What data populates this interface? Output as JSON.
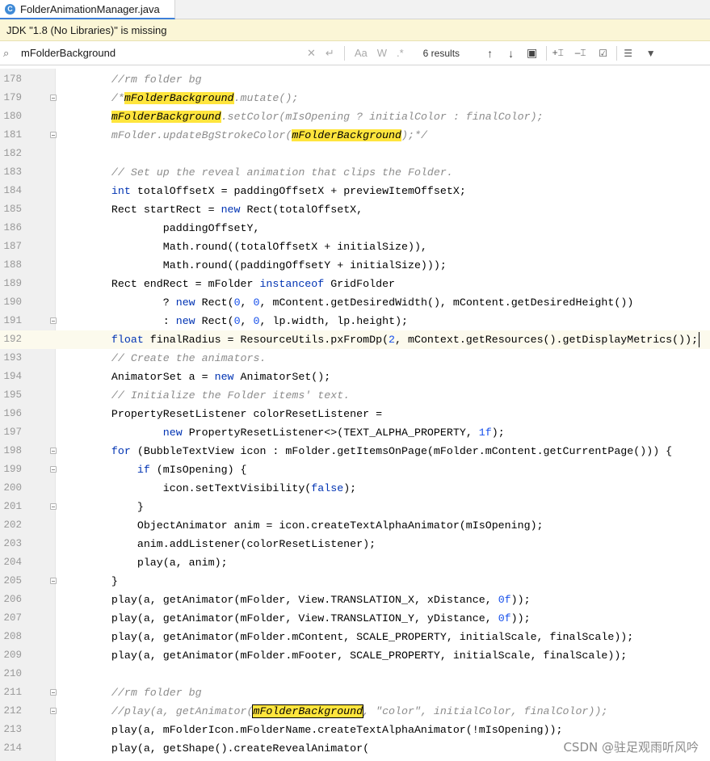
{
  "editor": {
    "tab": {
      "icon": "java-class-icon",
      "icon_glyph": "C",
      "title": "FolderAnimationManager.java"
    },
    "notice": "JDK \"1.8 (No Libraries)\" is missing",
    "find": {
      "query": "mFolderBackground",
      "results": "6 results",
      "icons": {
        "search": "search-icon",
        "clear": "clear-icon",
        "history": "replace-history-icon",
        "match_case": "match-case-icon",
        "words": "whole-words-icon",
        "regex": "regex-icon",
        "prev": "previous-occurrence-icon",
        "next": "next-occurrence-icon",
        "select_all": "select-all-occurrences-icon",
        "add": "add-selection-icon",
        "remove": "remove-selection-icon",
        "select_all2": "select-all-matches-icon",
        "filter_lines": "filter-lines-icon",
        "filter": "filter-icon"
      }
    },
    "watermark": "CSDN @驻足观雨听风吟",
    "current_line": 192,
    "lines": [
      {
        "n": "178",
        "fold": false,
        "tokens": [
          [
            "    //rm folder bg",
            "com"
          ]
        ]
      },
      {
        "n": "179",
        "fold": true,
        "tokens": [
          [
            "    /*",
            "com"
          ],
          [
            "mFolderBackground",
            "hl"
          ],
          [
            ".mutate();",
            "com"
          ]
        ]
      },
      {
        "n": "180",
        "fold": false,
        "tokens": [
          [
            "    ",
            ""
          ],
          [
            "mFolderBackground",
            "hl"
          ],
          [
            ".setColor(mIsOpening ? initialColor : finalColor);",
            "com"
          ]
        ]
      },
      {
        "n": "181",
        "fold": true,
        "tokens": [
          [
            "    mFolder.updateBgStrokeColor(",
            "com"
          ],
          [
            "mFolderBackground",
            "hl"
          ],
          [
            ");*/",
            "com"
          ]
        ]
      },
      {
        "n": "182",
        "fold": false,
        "tokens": []
      },
      {
        "n": "183",
        "fold": false,
        "tokens": [
          [
            "    // Set up the reveal animation that clips the Folder.",
            "com"
          ]
        ]
      },
      {
        "n": "184",
        "fold": false,
        "tokens": [
          [
            "    ",
            ""
          ],
          [
            "int",
            "kw"
          ],
          [
            " totalOffsetX = paddingOffsetX + previewItemOffsetX;",
            ""
          ]
        ]
      },
      {
        "n": "185",
        "fold": false,
        "tokens": [
          [
            "    Rect startRect = ",
            ""
          ],
          [
            "new",
            "kw"
          ],
          [
            " Rect(totalOffsetX,",
            ""
          ]
        ]
      },
      {
        "n": "186",
        "fold": false,
        "tokens": [
          [
            "            paddingOffsetY,",
            ""
          ]
        ]
      },
      {
        "n": "187",
        "fold": false,
        "tokens": [
          [
            "            Math.round((totalOffsetX + initialSize)),",
            ""
          ]
        ]
      },
      {
        "n": "188",
        "fold": false,
        "tokens": [
          [
            "            Math.round((paddingOffsetY + initialSize)));",
            ""
          ]
        ]
      },
      {
        "n": "189",
        "fold": false,
        "tokens": [
          [
            "    Rect endRect = mFolder ",
            ""
          ],
          [
            "instanceof",
            "kw"
          ],
          [
            " GridFolder",
            ""
          ]
        ]
      },
      {
        "n": "190",
        "fold": false,
        "tokens": [
          [
            "            ? ",
            ""
          ],
          [
            "new",
            "kw"
          ],
          [
            " Rect(",
            ""
          ],
          [
            "0",
            "num"
          ],
          [
            ", ",
            ""
          ],
          [
            "0",
            "num"
          ],
          [
            ", mContent.getDesiredWidth(), mContent.getDesiredHeight())",
            ""
          ]
        ]
      },
      {
        "n": "191",
        "fold": true,
        "tokens": [
          [
            "            : ",
            ""
          ],
          [
            "new",
            "kw"
          ],
          [
            " Rect(",
            ""
          ],
          [
            "0",
            "num"
          ],
          [
            ", ",
            ""
          ],
          [
            "0",
            "num"
          ],
          [
            ", lp.width, lp.height);",
            ""
          ]
        ]
      },
      {
        "n": "192",
        "fold": false,
        "tokens": [
          [
            "    ",
            ""
          ],
          [
            "float",
            "kw"
          ],
          [
            " finalRadius = ResourceUtils.pxFromDp(",
            ""
          ],
          [
            "2",
            "num"
          ],
          [
            ", mContext.getResources().getDisplayMetrics());",
            ""
          ]
        ]
      },
      {
        "n": "193",
        "fold": false,
        "tokens": [
          [
            "    // Create the animators.",
            "com"
          ]
        ]
      },
      {
        "n": "194",
        "fold": false,
        "tokens": [
          [
            "    AnimatorSet a = ",
            ""
          ],
          [
            "new",
            "kw"
          ],
          [
            " AnimatorSet();",
            ""
          ]
        ]
      },
      {
        "n": "195",
        "fold": false,
        "tokens": [
          [
            "    // Initialize the Folder items' text.",
            "com"
          ]
        ]
      },
      {
        "n": "196",
        "fold": false,
        "tokens": [
          [
            "    PropertyResetListener colorResetListener =",
            ""
          ]
        ]
      },
      {
        "n": "197",
        "fold": false,
        "tokens": [
          [
            "            ",
            ""
          ],
          [
            "new",
            "kw"
          ],
          [
            " PropertyResetListener<>(TEXT_ALPHA_PROPERTY, ",
            ""
          ],
          [
            "1f",
            "num"
          ],
          [
            ");",
            ""
          ]
        ]
      },
      {
        "n": "198",
        "fold": true,
        "tokens": [
          [
            "    ",
            ""
          ],
          [
            "for",
            "kw"
          ],
          [
            " (BubbleTextView icon : mFolder.getItemsOnPage(mFolder.mContent.getCurrentPage())) {",
            ""
          ]
        ]
      },
      {
        "n": "199",
        "fold": true,
        "tokens": [
          [
            "        ",
            ""
          ],
          [
            "if",
            "kw"
          ],
          [
            " (mIsOpening) {",
            ""
          ]
        ]
      },
      {
        "n": "200",
        "fold": false,
        "tokens": [
          [
            "            icon.setTextVisibility(",
            ""
          ],
          [
            "false",
            "kw"
          ],
          [
            ");",
            ""
          ]
        ]
      },
      {
        "n": "201",
        "fold": true,
        "tokens": [
          [
            "        }",
            ""
          ]
        ]
      },
      {
        "n": "202",
        "fold": false,
        "tokens": [
          [
            "        ObjectAnimator anim = icon.createTextAlphaAnimator(mIsOpening);",
            ""
          ]
        ]
      },
      {
        "n": "203",
        "fold": false,
        "tokens": [
          [
            "        anim.addListener(colorResetListener);",
            ""
          ]
        ]
      },
      {
        "n": "204",
        "fold": false,
        "tokens": [
          [
            "        play(a, anim);",
            ""
          ]
        ]
      },
      {
        "n": "205",
        "fold": true,
        "tokens": [
          [
            "    }",
            ""
          ]
        ]
      },
      {
        "n": "206",
        "fold": false,
        "tokens": [
          [
            "    play(a, getAnimator(mFolder, View.TRANSLATION_X, xDistance, ",
            ""
          ],
          [
            "0f",
            "num"
          ],
          [
            "));",
            ""
          ]
        ]
      },
      {
        "n": "207",
        "fold": false,
        "tokens": [
          [
            "    play(a, getAnimator(mFolder, View.TRANSLATION_Y, yDistance, ",
            ""
          ],
          [
            "0f",
            "num"
          ],
          [
            "));",
            ""
          ]
        ]
      },
      {
        "n": "208",
        "fold": false,
        "tokens": [
          [
            "    play(a, getAnimator(mFolder.mContent, SCALE_PROPERTY, initialScale, finalScale));",
            ""
          ]
        ]
      },
      {
        "n": "209",
        "fold": false,
        "tokens": [
          [
            "    play(a, getAnimator(mFolder.mFooter, SCALE_PROPERTY, initialScale, finalScale));",
            ""
          ]
        ]
      },
      {
        "n": "210",
        "fold": false,
        "tokens": []
      },
      {
        "n": "211",
        "fold": true,
        "tokens": [
          [
            "    //rm folder bg",
            "com"
          ]
        ]
      },
      {
        "n": "212",
        "fold": true,
        "tokens": [
          [
            "    //play(a, getAnimator(",
            "com"
          ],
          [
            "mFolderBackground",
            "hlb"
          ],
          [
            ", \"color\", initialColor, finalColor));",
            "com"
          ]
        ]
      },
      {
        "n": "213",
        "fold": false,
        "tokens": [
          [
            "    play(a, mFolderIcon.mFolderName.createTextAlphaAnimator(!mIsOpening));",
            ""
          ]
        ]
      },
      {
        "n": "214",
        "fold": false,
        "tokens": [
          [
            "    play(a, getShape().createRevealAnimator(",
            ""
          ]
        ]
      }
    ]
  }
}
